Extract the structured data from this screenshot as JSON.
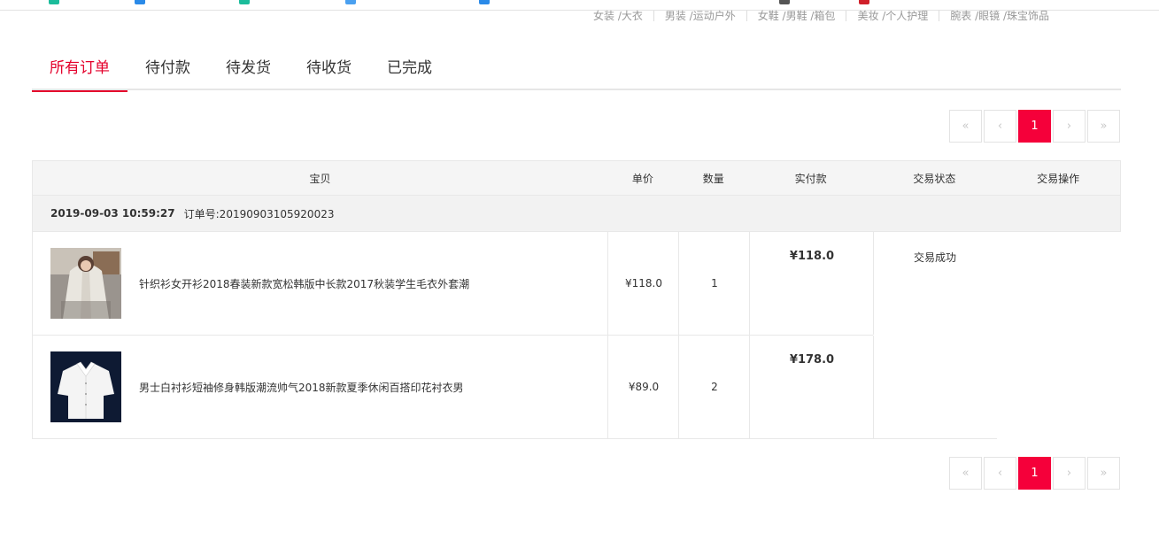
{
  "categories": [
    "女装 /大衣",
    "男装 /运动户外",
    "女鞋 /男鞋 /箱包",
    "美妆 /个人护理",
    "腕表 /眼镜 /珠宝饰品"
  ],
  "tabs": [
    "所有订单",
    "待付款",
    "待发货",
    "待收货",
    "已完成"
  ],
  "active_tab": 0,
  "pager": {
    "first": "«",
    "prev": "‹",
    "current": "1",
    "next": "›",
    "last": "»"
  },
  "table": {
    "headers": {
      "item": "宝贝",
      "price": "单价",
      "qty": "数量",
      "paid": "实付款",
      "status": "交易状态",
      "ops": "交易操作"
    },
    "order": {
      "time": "2019-09-03 10:59:27",
      "number": "订单号:20190903105920023",
      "status": "交易成功",
      "items": [
        {
          "name": "针织衫女开衫2018春装新款宽松韩版中长款2017秋装学生毛衣外套潮",
          "price": "¥118.0",
          "qty": "1",
          "paid": "¥118.0"
        },
        {
          "name": "男士白衬衫短袖修身韩版潮流帅气2018新款夏季休闲百搭印花衬衣男",
          "price": "¥89.0",
          "qty": "2",
          "paid": "¥178.0"
        }
      ]
    }
  },
  "colors": {
    "accent": "#e4002b",
    "pager_active": "#f5003a"
  }
}
